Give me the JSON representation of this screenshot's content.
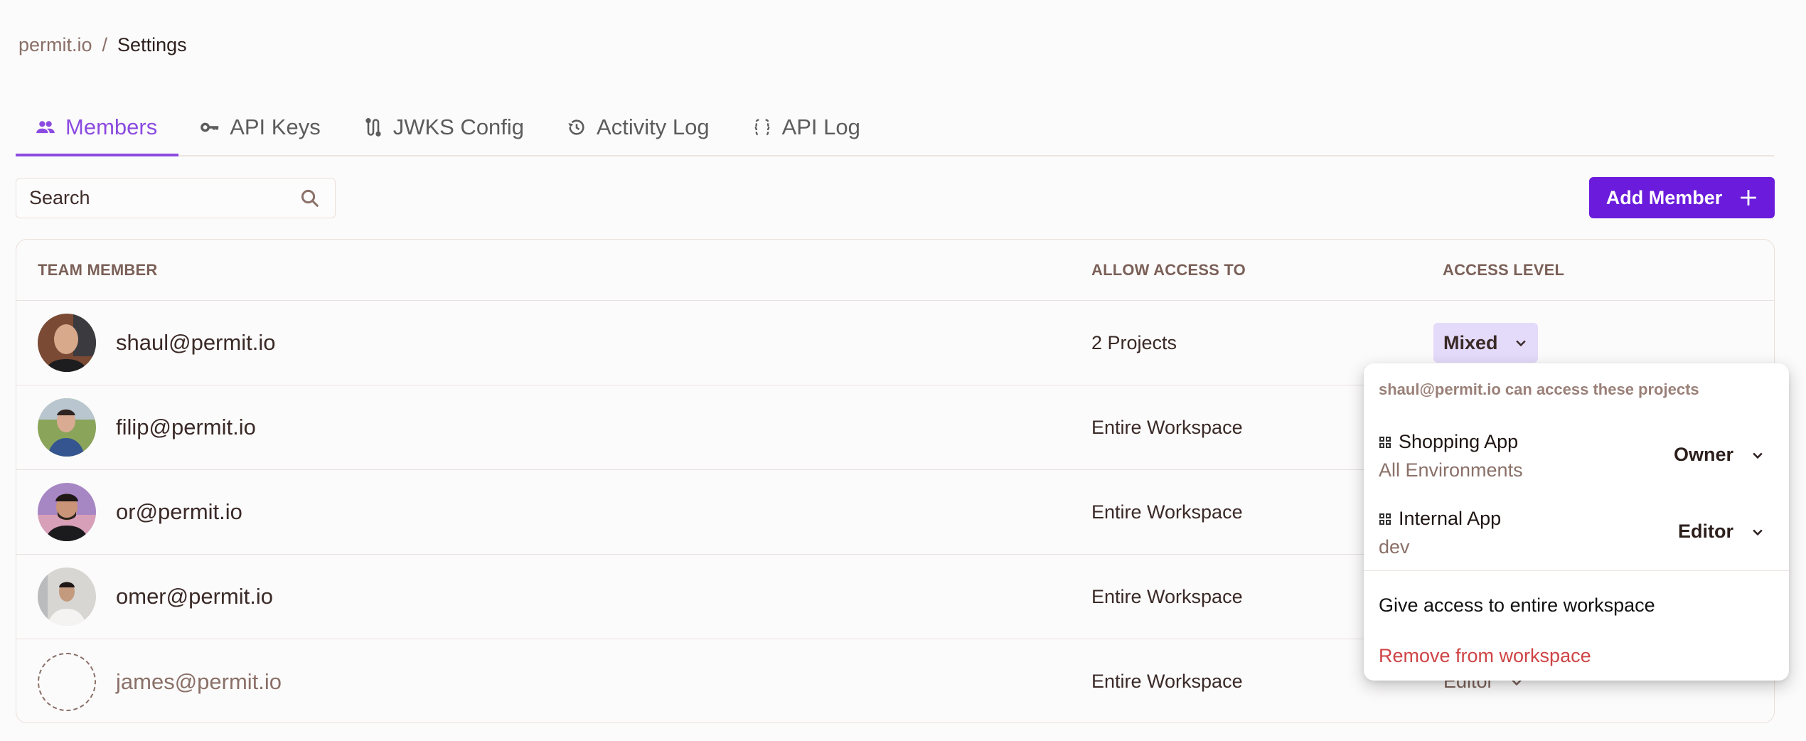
{
  "breadcrumb": {
    "root": "permit.io",
    "separator": "/",
    "current": "Settings"
  },
  "tabs": [
    {
      "label": "Members",
      "icon": "people-icon",
      "active": true
    },
    {
      "label": "API Keys",
      "icon": "key-icon",
      "active": false
    },
    {
      "label": "JWKS Config",
      "icon": "route-icon",
      "active": false
    },
    {
      "label": "Activity Log",
      "icon": "history-icon",
      "active": false
    },
    {
      "label": "API Log",
      "icon": "braces-icon",
      "active": false
    }
  ],
  "search": {
    "placeholder": "Search",
    "value": ""
  },
  "add_member_button": {
    "label": "Add Member"
  },
  "table": {
    "headers": {
      "member": "TEAM MEMBER",
      "access": "ALLOW ACCESS TO",
      "level": "ACCESS LEVEL"
    },
    "rows": [
      {
        "email": "shaul@permit.io",
        "access": "2 Projects",
        "level": "Mixed",
        "pending": false
      },
      {
        "email": "filip@permit.io",
        "access": "Entire Workspace",
        "level": "",
        "pending": false
      },
      {
        "email": "or@permit.io",
        "access": "Entire Workspace",
        "level": "",
        "pending": false
      },
      {
        "email": "omer@permit.io",
        "access": "Entire Workspace",
        "level": "",
        "pending": false
      },
      {
        "email": "james@permit.io",
        "access": "Entire Workspace",
        "level": "Editor",
        "pending": true
      }
    ]
  },
  "popup": {
    "title": "shaul@permit.io can access these projects",
    "projects": [
      {
        "name": "Shopping App",
        "environment": "All Environments",
        "role": "Owner"
      },
      {
        "name": "Internal App",
        "environment": "dev",
        "role": "Editor"
      }
    ],
    "give_access_label": "Give access to entire workspace",
    "remove_label": "Remove from workspace"
  },
  "colors": {
    "accent": "#8b4be0",
    "primary_button": "#6a1bdb",
    "mixed_badge_bg": "#e4dafa",
    "danger": "#cf4446"
  }
}
